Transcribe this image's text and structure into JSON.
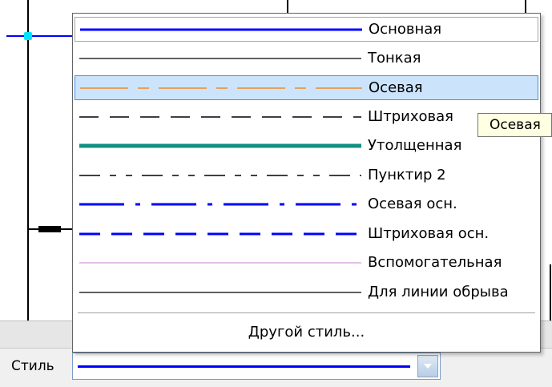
{
  "dropdown": {
    "items": [
      {
        "label": "Основная",
        "state": "boxed",
        "line": {
          "color": "#0000ff",
          "width": 3,
          "dash": ""
        }
      },
      {
        "label": "Тонкая",
        "state": "normal",
        "line": {
          "color": "#000000",
          "width": 1.2,
          "dash": ""
        }
      },
      {
        "label": "Осевая",
        "state": "highlighted",
        "line": {
          "color": "#f08a24",
          "width": 1.5,
          "dash": "60 12 14 12"
        }
      },
      {
        "label": "Штриховая",
        "state": "normal",
        "line": {
          "color": "#000000",
          "width": 1.5,
          "dash": "24 14"
        }
      },
      {
        "label": "Утолщенная",
        "state": "normal",
        "line": {
          "color": "#109080",
          "width": 5,
          "dash": ""
        }
      },
      {
        "label": "Пунктир 2",
        "state": "normal",
        "line": {
          "color": "#000000",
          "width": 1.5,
          "dash": "26 12 8 12 8 12"
        }
      },
      {
        "label": "Осевая осн.",
        "state": "normal",
        "line": {
          "color": "#0000ff",
          "width": 3,
          "dash": "56 14 6 14"
        }
      },
      {
        "label": "Штриховая осн.",
        "state": "normal",
        "line": {
          "color": "#0000ff",
          "width": 3,
          "dash": "26 14"
        }
      },
      {
        "label": "Вспомогательная",
        "state": "normal",
        "line": {
          "color": "#d39bd6",
          "width": 1.3,
          "dash": ""
        }
      },
      {
        "label": "Для линии обрыва",
        "state": "normal",
        "line": {
          "color": "#000000",
          "width": 1.3,
          "dash": ""
        }
      }
    ],
    "other_style_label": "Другой стиль..."
  },
  "tooltip": {
    "text": "Осевая"
  },
  "style_field": {
    "label": "Стиль",
    "selected_line_color": "#0000ff"
  }
}
